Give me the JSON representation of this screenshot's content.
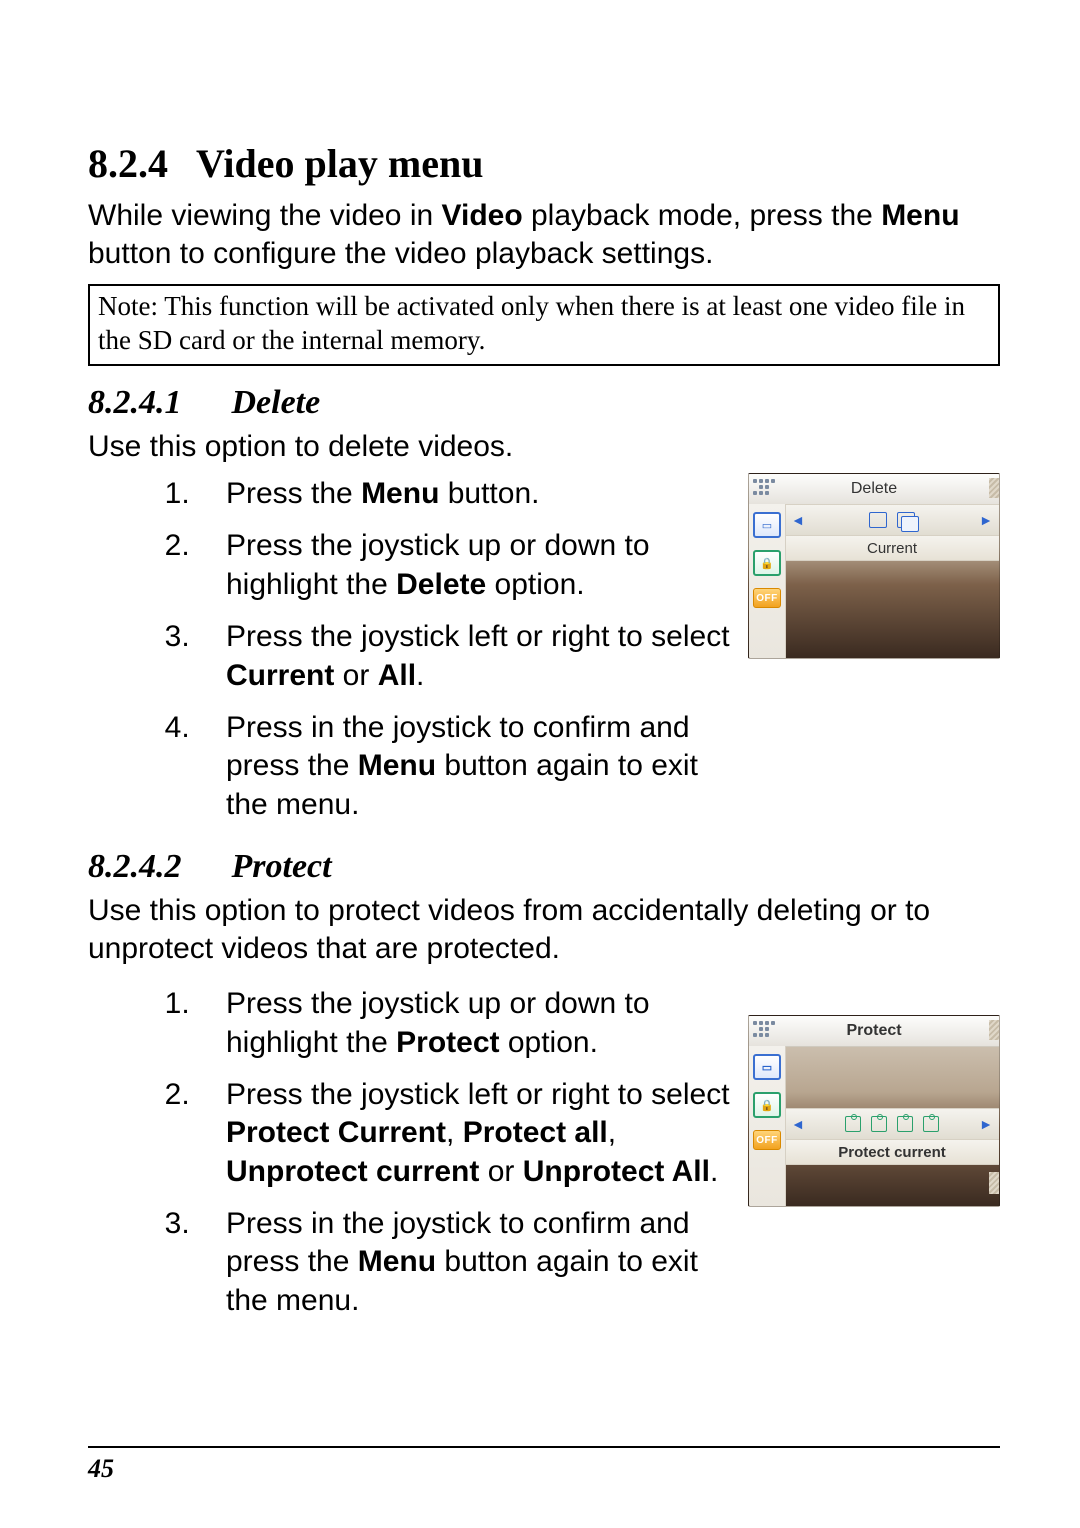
{
  "section": {
    "number": "8.2.4",
    "title": "Video play menu"
  },
  "intro": {
    "pre": "While viewing the video in ",
    "bold1": "Video",
    "mid": " playback mode, press the ",
    "bold2": "Menu",
    "post": " button to configure the video playback settings."
  },
  "note": "Note: This function will be activated only when there is at least one video file in the SD card or the internal memory.",
  "delete": {
    "number": "8.2.4.1",
    "title": "Delete",
    "lead": "Use this option to delete videos.",
    "steps": [
      {
        "parts": [
          {
            "t": "Press the "
          },
          {
            "t": "Menu",
            "b": true
          },
          {
            "t": " button."
          }
        ]
      },
      {
        "parts": [
          {
            "t": "Press the joystick up or down to highlight the "
          },
          {
            "t": "Delete",
            "b": true
          },
          {
            "t": " option."
          }
        ]
      },
      {
        "parts": [
          {
            "t": "Press the joystick left or right to select "
          },
          {
            "t": "Current",
            "b": true
          },
          {
            "t": " or "
          },
          {
            "t": "All",
            "b": true
          },
          {
            "t": "."
          }
        ]
      },
      {
        "parts": [
          {
            "t": "Press in the joystick to confirm and press the "
          },
          {
            "t": "Menu",
            "b": true
          },
          {
            "t": " button again to exit the menu."
          }
        ]
      }
    ],
    "shot": {
      "title": "Delete",
      "caption": "Current",
      "off": "OFF"
    }
  },
  "protect": {
    "number": "8.2.4.2",
    "title": "Protect",
    "lead": "Use this option to protect videos from accidentally deleting or to unprotect videos that are protected.",
    "steps": [
      {
        "parts": [
          {
            "t": "Press the joystick up or down to highlight the "
          },
          {
            "t": "Protect",
            "b": true
          },
          {
            "t": " option."
          }
        ]
      },
      {
        "parts": [
          {
            "t": "Press the joystick left or right to select "
          },
          {
            "t": "Protect Current",
            "b": true
          },
          {
            "t": ", "
          },
          {
            "t": "Protect all",
            "b": true
          },
          {
            "t": ", "
          },
          {
            "t": "Unprotect current",
            "b": true
          },
          {
            "t": " or "
          },
          {
            "t": "Unprotect All",
            "b": true
          },
          {
            "t": "."
          }
        ]
      },
      {
        "parts": [
          {
            "t": "Press in the joystick to confirm and press the "
          },
          {
            "t": "Menu",
            "b": true
          },
          {
            "t": " button again to exit the menu."
          }
        ]
      }
    ],
    "shot": {
      "title": "Protect",
      "caption": "Protect current",
      "off": "OFF"
    }
  },
  "pageNumber": "45"
}
